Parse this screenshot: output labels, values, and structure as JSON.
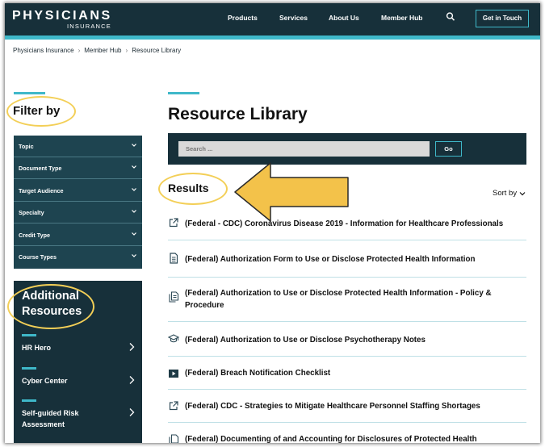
{
  "header": {
    "logo_main": "PHYSICIANS",
    "logo_sub": "INSURANCE",
    "nav": [
      "Products",
      "Services",
      "About Us",
      "Member Hub"
    ],
    "search_icon": "search-icon",
    "cta": "Get in Touch"
  },
  "breadcrumb": [
    "Physicians Insurance",
    "Member Hub",
    "Resource Library"
  ],
  "filter": {
    "title": "Filter by",
    "items": [
      "Topic",
      "Document Type",
      "Target Audience",
      "Specialty",
      "Credit Type",
      "Course Types"
    ]
  },
  "additional": {
    "title": "Additional Resources",
    "links": [
      "HR Hero",
      "Cyber Center",
      "Self-guided Risk Assessment"
    ]
  },
  "main": {
    "title": "Resource Library",
    "search_placeholder": "Search ...",
    "search_button": "Go",
    "results_title": "Results",
    "sort_label": "Sort by"
  },
  "results": [
    {
      "icon": "external-link-icon",
      "title": "(Federal - CDC) Coronavirus Disease 2019 - Information for Healthcare Professionals"
    },
    {
      "icon": "document-icon",
      "title": "(Federal) Authorization Form to Use or Disclose Protected Health Information"
    },
    {
      "icon": "documents-icon",
      "title": "(Federal) Authorization to Use or Disclose Protected Health Information - Policy & Procedure"
    },
    {
      "icon": "graduation-cap-icon",
      "title": "(Federal) Authorization to Use or Disclose Psychotherapy Notes"
    },
    {
      "icon": "video-play-icon",
      "title": "(Federal) Breach Notification Checklist"
    },
    {
      "icon": "external-link-icon",
      "title": "(Federal) CDC - Strategies to Mitigate Healthcare Personnel Staffing Shortages"
    },
    {
      "icon": "documents-icon",
      "title": "(Federal) Documenting of and Accounting for Disclosures of Protected Health"
    }
  ],
  "colors": {
    "navy": "#17303a",
    "teal_panel": "#1e4450",
    "accent": "#3fb8c9",
    "annotation": "#f3cf57"
  }
}
